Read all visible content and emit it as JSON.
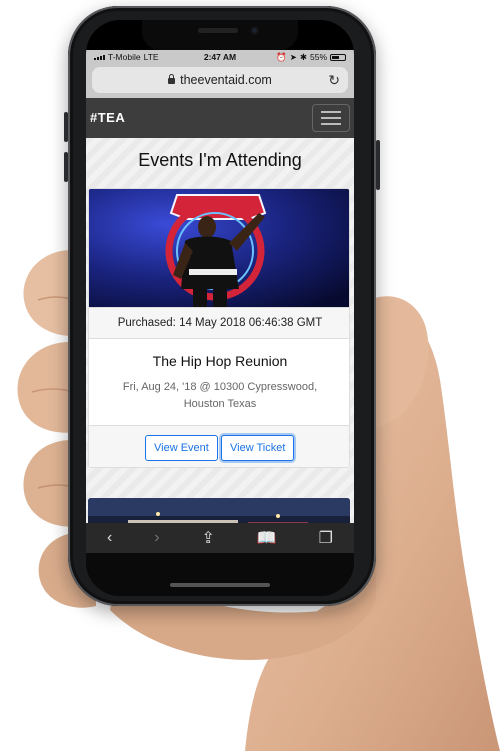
{
  "status_bar": {
    "carrier": "T-Mobile",
    "network": "LTE",
    "time": "2:47 AM",
    "battery": "55%"
  },
  "browser": {
    "url": "theeventaid.com"
  },
  "navbar": {
    "brand": "#TEA"
  },
  "page": {
    "title": "Events I'm Attending"
  },
  "events": [
    {
      "purchased": "Purchased: 14 May 2018 06:46:38 GMT",
      "title": "The Hip Hop Reunion",
      "date_location": "Fri, Aug 24, '18 @ 10300 Cypresswood, Houston Texas",
      "view_event_label": "View Event",
      "view_ticket_label": "View Ticket"
    }
  ],
  "toolbar": {
    "icons": [
      "back-icon",
      "forward-icon",
      "share-icon",
      "bookmarks-icon",
      "tabs-icon"
    ]
  },
  "colors": {
    "navbar": "#3d3d3d",
    "button_accent": "#1a73e8",
    "stage_blue": "#0c0f3a",
    "sign_red": "#d3243a"
  }
}
